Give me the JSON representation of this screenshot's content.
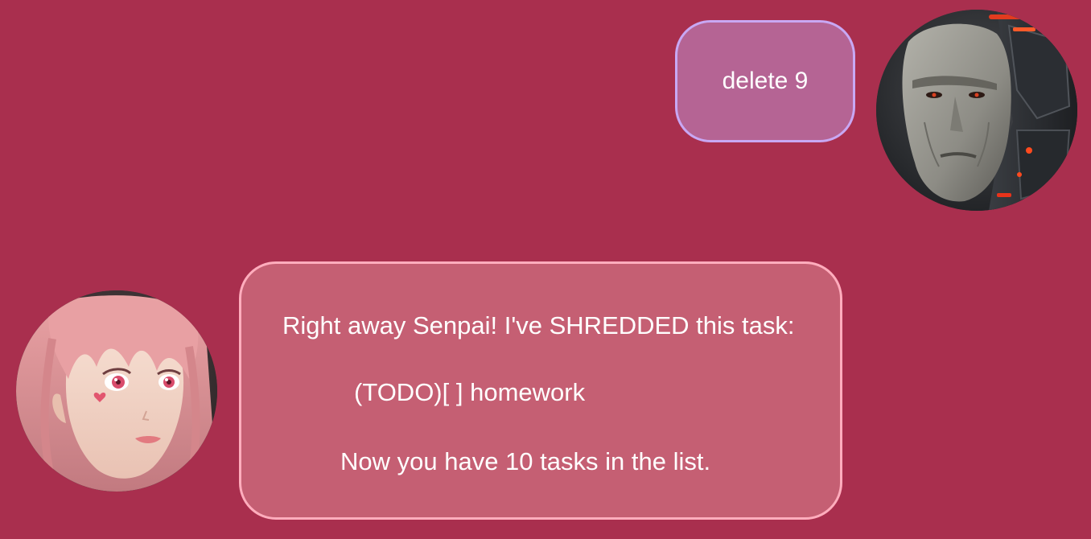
{
  "chat": {
    "messages": [
      {
        "sender": "user",
        "avatar": "cyborg-man-avatar",
        "text": "delete 9"
      },
      {
        "sender": "bot",
        "avatar": "pink-hair-girl-avatar",
        "lines": [
          "Right away Senpai! I've SHREDDED this task:",
          "(TODO)[ ] homework",
          "Now you have 10 tasks in the list."
        ]
      }
    ]
  },
  "colors": {
    "background": "#a92f4e",
    "user_bubble": "#b56494",
    "user_bubble_border": "#c8a8f4",
    "bot_bubble": "#c55f73",
    "bot_bubble_border": "#ffadbd",
    "text": "#ffffff"
  }
}
